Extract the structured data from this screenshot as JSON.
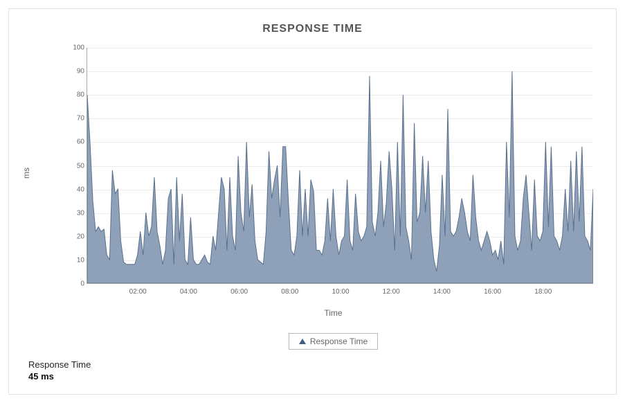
{
  "chart_data": {
    "type": "area",
    "title": "RESPONSE TIME",
    "xlabel": "Time",
    "ylabel": "ms",
    "ylim": [
      0,
      100
    ],
    "y_ticks": [
      0,
      10,
      20,
      30,
      40,
      50,
      60,
      70,
      80,
      90,
      100
    ],
    "x_ticks": [
      "02:00",
      "04:00",
      "06:00",
      "08:00",
      "10:00",
      "12:00",
      "14:00",
      "16:00",
      "18:00"
    ],
    "legend": "Response Time",
    "series": [
      {
        "name": "Response Time",
        "color": "#8fa1b9",
        "values": [
          80,
          60,
          35,
          22,
          24,
          22,
          23,
          12,
          10,
          48,
          38,
          40,
          18,
          9,
          8,
          8,
          8,
          8,
          12,
          22,
          12,
          30,
          20,
          24,
          45,
          22,
          16,
          8,
          14,
          36,
          40,
          8,
          45,
          18,
          38,
          10,
          8,
          28,
          10,
          8,
          8,
          10,
          12,
          9,
          8,
          20,
          14,
          30,
          45,
          40,
          14,
          45,
          20,
          14,
          54,
          30,
          22,
          60,
          28,
          42,
          18,
          10,
          9,
          8,
          22,
          56,
          36,
          44,
          50,
          28,
          58,
          58,
          34,
          14,
          12,
          20,
          48,
          20,
          40,
          20,
          44,
          39,
          14,
          14,
          12,
          18,
          36,
          18,
          40,
          20,
          12,
          18,
          20,
          44,
          18,
          14,
          38,
          22,
          18,
          20,
          24,
          88,
          26,
          20,
          30,
          52,
          24,
          34,
          56,
          40,
          14,
          60,
          20,
          80,
          24,
          18,
          10,
          68,
          26,
          30,
          54,
          30,
          52,
          22,
          10,
          5,
          16,
          46,
          20,
          74,
          22,
          20,
          22,
          28,
          36,
          30,
          22,
          18,
          46,
          28,
          18,
          14,
          18,
          22,
          18,
          12,
          14,
          10,
          18,
          8,
          60,
          28,
          90,
          20,
          14,
          18,
          36,
          46,
          30,
          14,
          44,
          20,
          18,
          22,
          60,
          24,
          58,
          20,
          18,
          14,
          20,
          40,
          22,
          52,
          22,
          56,
          26,
          58,
          20,
          18,
          14,
          40
        ]
      }
    ]
  },
  "summary": {
    "label": "Response Time",
    "value": "45 ms"
  }
}
